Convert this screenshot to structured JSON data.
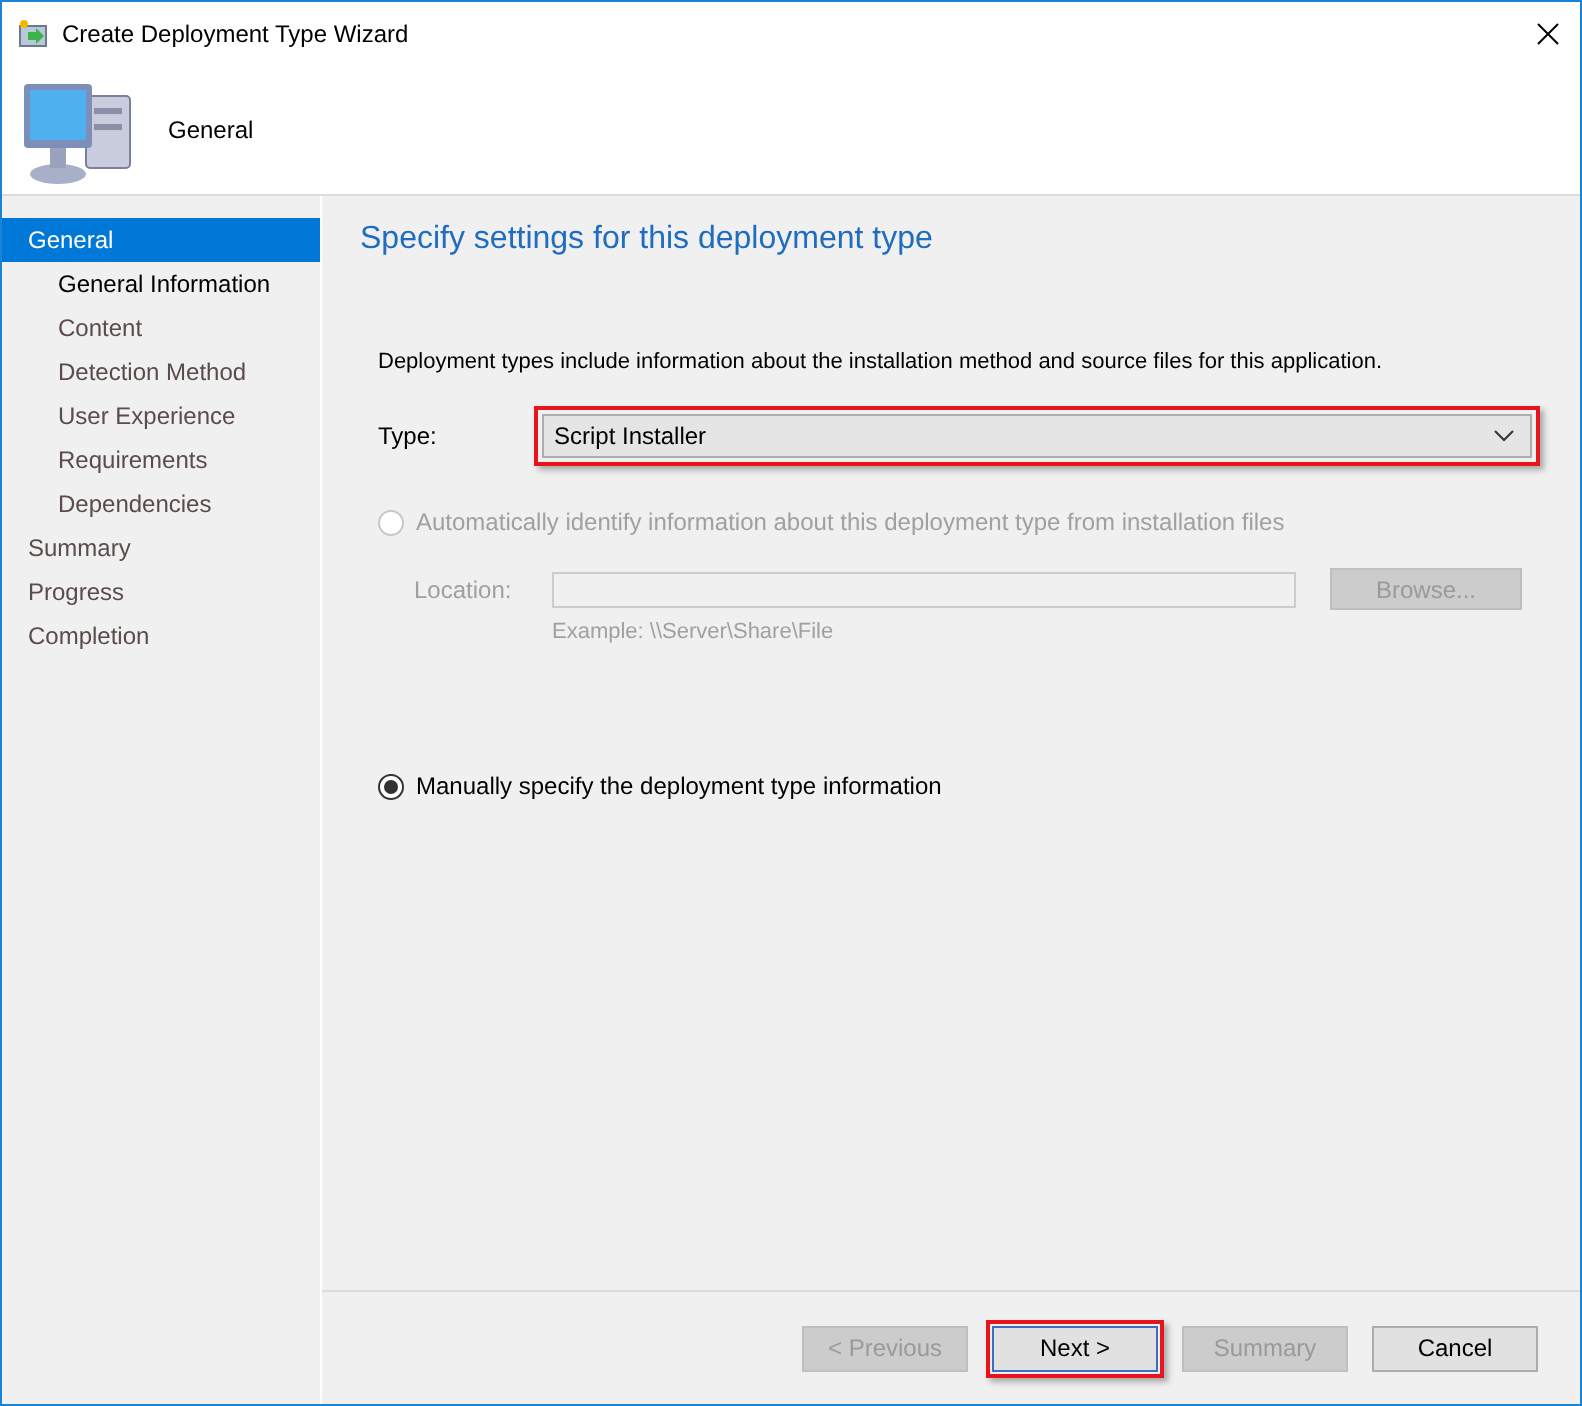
{
  "window": {
    "title": "Create Deployment Type Wizard"
  },
  "header": {
    "title": "General"
  },
  "sidebar": {
    "items": [
      {
        "label": "General",
        "selected": true,
        "current": false,
        "children": [
          {
            "label": "General Information",
            "selected": false,
            "current": true
          },
          {
            "label": "Content",
            "selected": false,
            "current": false
          },
          {
            "label": "Detection Method",
            "selected": false,
            "current": false
          },
          {
            "label": "User Experience",
            "selected": false,
            "current": false
          },
          {
            "label": "Requirements",
            "selected": false,
            "current": false
          },
          {
            "label": "Dependencies",
            "selected": false,
            "current": false
          }
        ]
      },
      {
        "label": "Summary",
        "selected": false,
        "current": false
      },
      {
        "label": "Progress",
        "selected": false,
        "current": false
      },
      {
        "label": "Completion",
        "selected": false,
        "current": false
      }
    ]
  },
  "content": {
    "heading": "Specify settings for this deployment type",
    "description": "Deployment types include information about the installation method and source files for this application.",
    "type_field": {
      "label": "Type:",
      "value": "Script Installer",
      "highlighted": true
    },
    "options": [
      {
        "label": "Automatically identify information about this deployment type from installation files",
        "selected": false,
        "disabled": true
      },
      {
        "label": "Manually specify the deployment type information",
        "selected": true,
        "disabled": false
      }
    ],
    "location": {
      "label": "Location:",
      "disabled": true,
      "browse": "Browse...",
      "example": "Example: \\\\Server\\Share\\File"
    }
  },
  "buttons": [
    {
      "label": "< Previous",
      "disabled": true,
      "highlighted": false
    },
    {
      "label": "Next >",
      "disabled": false,
      "highlighted": true
    },
    {
      "label": "Summary",
      "disabled": true,
      "highlighted": false
    },
    {
      "label": "Cancel",
      "disabled": false,
      "highlighted": false
    }
  ]
}
